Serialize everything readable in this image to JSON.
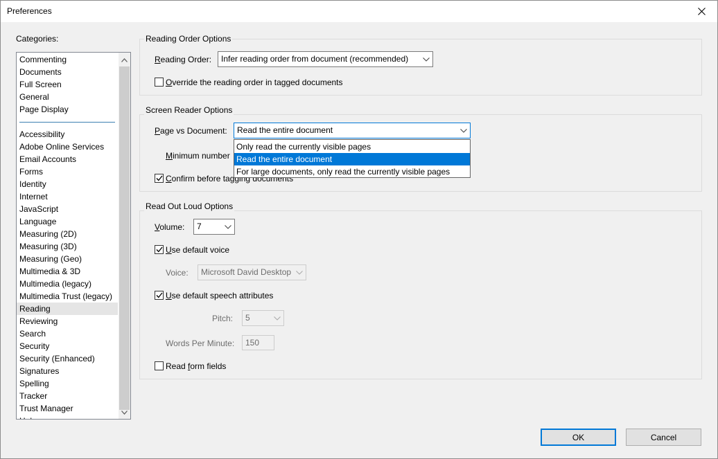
{
  "window": {
    "title": "Preferences"
  },
  "categories": {
    "label": "Categories:",
    "top_group": [
      "Commenting",
      "Documents",
      "Full Screen",
      "General",
      "Page Display"
    ],
    "items": [
      "Accessibility",
      "Adobe Online Services",
      "Email Accounts",
      "Forms",
      "Identity",
      "Internet",
      "JavaScript",
      "Language",
      "Measuring (2D)",
      "Measuring (3D)",
      "Measuring (Geo)",
      "Multimedia & 3D",
      "Multimedia (legacy)",
      "Multimedia Trust (legacy)",
      "Reading",
      "Reviewing",
      "Search",
      "Security",
      "Security (Enhanced)",
      "Signatures",
      "Spelling",
      "Tracker",
      "Trust Manager"
    ],
    "selected": "Reading"
  },
  "reading_order": {
    "group_title": "Reading Order Options",
    "label": "Reading Order:",
    "value": "Infer reading order from document (recommended)",
    "override_label": "Override the reading order in tagged documents",
    "override_checked": false
  },
  "screen_reader": {
    "group_title": "Screen Reader Options",
    "page_vs_doc_label": "Page vs Document:",
    "page_vs_doc_value": "Read the entire document",
    "dropdown_options": [
      "Only read the currently visible pages",
      "Read the entire document",
      "For large documents, only read the currently visible pages"
    ],
    "dropdown_selected_index": 1,
    "min_number_label": "Minimum number",
    "confirm_label": "Confirm before tagging documents",
    "confirm_checked": true
  },
  "read_out_loud": {
    "group_title": "Read Out Loud Options",
    "volume_label": "Volume:",
    "volume_value": "7",
    "default_voice_label": "Use default voice",
    "default_voice_checked": true,
    "voice_label": "Voice:",
    "voice_value": "Microsoft David Desktop",
    "default_speech_label": "Use default speech attributes",
    "default_speech_checked": true,
    "pitch_label": "Pitch:",
    "pitch_value": "5",
    "wpm_label": "Words Per Minute:",
    "wpm_value": "150",
    "form_fields_label": "Read form fields",
    "form_fields_checked": false
  },
  "buttons": {
    "ok": "OK",
    "cancel": "Cancel"
  }
}
